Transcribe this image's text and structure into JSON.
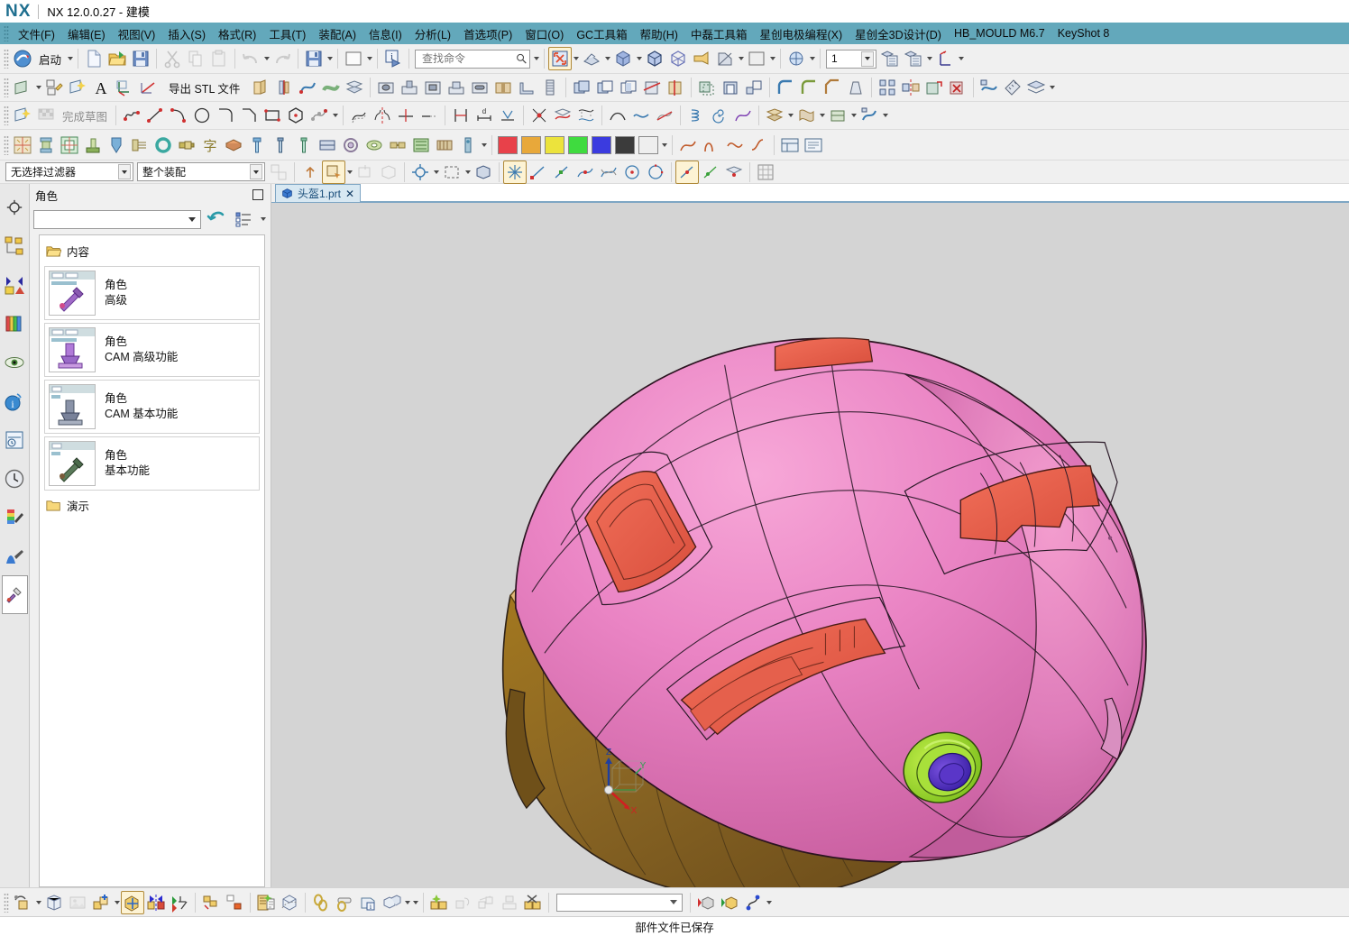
{
  "window": {
    "logo": "NX",
    "title": "NX 12.0.0.27 - 建模"
  },
  "menu": {
    "items": [
      {
        "label": "文件(F)"
      },
      {
        "label": "编辑(E)"
      },
      {
        "label": "视图(V)"
      },
      {
        "label": "插入(S)"
      },
      {
        "label": "格式(R)"
      },
      {
        "label": "工具(T)"
      },
      {
        "label": "装配(A)"
      },
      {
        "label": "信息(I)"
      },
      {
        "label": "分析(L)"
      },
      {
        "label": "首选项(P)"
      },
      {
        "label": "窗口(O)"
      },
      {
        "label": "GC工具箱"
      },
      {
        "label": "帮助(H)"
      },
      {
        "label": "中磊工具箱"
      },
      {
        "label": "星创电极编程(X)"
      },
      {
        "label": "星创全3D设计(D)"
      },
      {
        "label": "HB_MOULD M6.7"
      },
      {
        "label": "KeyShot 8"
      }
    ]
  },
  "toolbar_row1": {
    "start_label": "启动",
    "search_placeholder": "查找命令",
    "search_value": "",
    "layer_value": "1",
    "icons": [
      "start-icon",
      "new-file-icon",
      "open-file-icon",
      "save-icon",
      "cut-icon",
      "copy-icon",
      "paste-icon",
      "undo-icon",
      "redo-icon",
      "save-as-icon",
      "blank-icon",
      "info-object-icon",
      "fit-view-icon",
      "perspective-icon",
      "shaded-icon",
      "shaded-edges-icon",
      "wireframe-icon",
      "render-style-icon",
      "section-icon",
      "background-icon",
      "layer-settings-icon",
      "move-to-layer-icon",
      "copy-to-layer-icon",
      "wcs-icon"
    ]
  },
  "toolbar_row2": {
    "export_stl_label": "导出 STL 文件",
    "icons": [
      "datum-plane-icon",
      "sketch-icon",
      "sketch-in-task-icon",
      "text-icon",
      "datum-csys-icon",
      "datum-axis-icon",
      "export-stl-icon",
      "extrude-icon",
      "revolve-icon",
      "sweep-icon",
      "tube-icon",
      "mesh-surface-icon",
      "through-curves-icon",
      "hole-icon",
      "boss-icon",
      "pocket-icon",
      "pad-icon",
      "slot-icon",
      "groove-icon",
      "rib-icon",
      "dart-icon",
      "thread-icon",
      "unite-icon",
      "subtract-icon",
      "intersect-icon",
      "trim-body-icon",
      "split-body-icon",
      "offset-face-icon",
      "shell-icon",
      "scale-icon",
      "pattern-icon",
      "mirror-icon",
      "edge-blend-icon",
      "face-blend-icon",
      "chamfer-icon",
      "draft-icon",
      "layer-mgr-icon"
    ]
  },
  "toolbar_row3": {
    "finish_sketch_label": "完成草图",
    "finish_sketch_disabled": true,
    "icons": [
      "sketch-in-task-icon",
      "finish-sketch-icon",
      "profile-icon",
      "line-icon",
      "arc-icon",
      "circle-icon",
      "fillet-icon",
      "chamfer2d-icon",
      "rectangle-icon",
      "polygon-icon",
      "studio-spline-icon",
      "ellipse-icon",
      "conic-icon",
      "offset-curve-icon",
      "mirror-curve-icon",
      "trim-curve-icon",
      "extend-curve-icon",
      "quick-trim-icon",
      "quick-extend-icon",
      "constraint-icon",
      "dimension-icon",
      "auto-dimension-icon",
      "relation-icon",
      "intersection-point-icon",
      "intersection-curve-icon",
      "project-curve-icon",
      "bridge-curve-icon",
      "join-curve-icon",
      "simplify-curve-icon",
      "derive-line-icon",
      "law-curve-icon",
      "helix-icon",
      "spiral-icon",
      "text-curve-icon"
    ]
  },
  "toolbar_row4": {
    "colors": [
      "#e8414a",
      "#e8a83a",
      "#ece33c",
      "#3fdb3f",
      "#3b3bdf",
      "#3b3b3b",
      "#eeeeee"
    ],
    "icons": [
      "mold-wizard-icon",
      "mold-base-icon",
      "cavity-layout-icon",
      "core-insert-icon",
      "slider-lifter-icon",
      "sub-insert-icon",
      "ejector-pin-icon",
      "standard-part-icon",
      "sprue-icon",
      "runner-icon",
      "gate-icon",
      "cooling-icon",
      "electrode-icon",
      "bom-icon",
      "drawing-icon",
      "pocket-tool-icon",
      "trim-mold-icon",
      "ring-icon",
      "screw-icon",
      "letter-icon",
      "box-icon",
      "pin-icon",
      "post-icon",
      "plate-icon",
      "spring-icon",
      "locating-ring-icon",
      "connector-icon",
      "chart-icon",
      "sensor-icon",
      "waterline-icon",
      "check-icon",
      "view-manager-icon"
    ]
  },
  "filter_bar": {
    "selection_filter": "无选择过滤器",
    "scope_filter": "整个装配",
    "icons": [
      "select-general-icon",
      "up-one-level-icon",
      "select-feature-icon",
      "select-face-icon",
      "select-body-icon"
    ]
  },
  "resource_rail": {
    "items": [
      {
        "name": "assembly-navigator-icon",
        "active": false
      },
      {
        "name": "constraint-navigator-icon",
        "active": false
      },
      {
        "name": "part-navigator-icon",
        "active": false
      },
      {
        "name": "reuse-library-icon",
        "active": false
      },
      {
        "name": "hd3d-tools-icon",
        "active": false
      },
      {
        "name": "web-browser-icon",
        "active": false
      },
      {
        "name": "history-icon",
        "active": false
      },
      {
        "name": "system-materials-icon",
        "active": false
      },
      {
        "name": "system-scenes-icon",
        "active": false
      },
      {
        "name": "roles-icon",
        "active": true
      }
    ]
  },
  "roles_panel": {
    "title": "角色",
    "combo_value": "",
    "content_folder": "内容",
    "demo_folder": "演示",
    "cards": [
      {
        "line1": "角色",
        "line2": "高级",
        "thumb": "role-advanced-thumb"
      },
      {
        "line1": "角色",
        "line2": "CAM 高级功能",
        "thumb": "role-cam-advanced-thumb"
      },
      {
        "line1": "角色",
        "line2": "CAM 基本功能",
        "thumb": "role-cam-basic-thumb"
      },
      {
        "line1": "角色",
        "line2": "基本功能",
        "thumb": "role-basic-thumb"
      }
    ]
  },
  "document": {
    "tab_label": "头盔1.prt",
    "tab_close": "✕"
  },
  "viewport": {
    "background": "#d4d4d4",
    "model": {
      "name": "helmet-3d-model",
      "shell_color": "#e87ec0",
      "brim_color": "#8a6124",
      "vent_color": "#e8604c",
      "trim_color": "#d4a45a",
      "dial_outer_color": "#9bdb35",
      "dial_inner_color": "#4a2ab5"
    },
    "triad": {
      "z_label": "Z",
      "y_label": "Y",
      "x_label": "X",
      "z_color": "#1f3fa0",
      "y_color": "#2f9f4f",
      "x_color": "#d02020"
    }
  },
  "bottom_toolbar": {
    "combo_value": "",
    "icons": [
      "move-object-icon",
      "wave-geometry-icon",
      "image-icon",
      "add-component-icon",
      "move-component-icon",
      "mirror-assembly-icon",
      "assembly-constraint-icon",
      "pattern-component-icon",
      "new-component-icon",
      "assembly-report-icon",
      "exploded-view-icon",
      "chain-icon",
      "measure-icon",
      "info-component-icon",
      "component-icon",
      "create-group-icon",
      "wave-link-icon",
      "deform-icon",
      "suppress-icon",
      "arrange-icon",
      "show-product-icon",
      "show-assembly-icon",
      "sequence-icon"
    ]
  },
  "status_bar": {
    "message": "部件文件已保存"
  }
}
